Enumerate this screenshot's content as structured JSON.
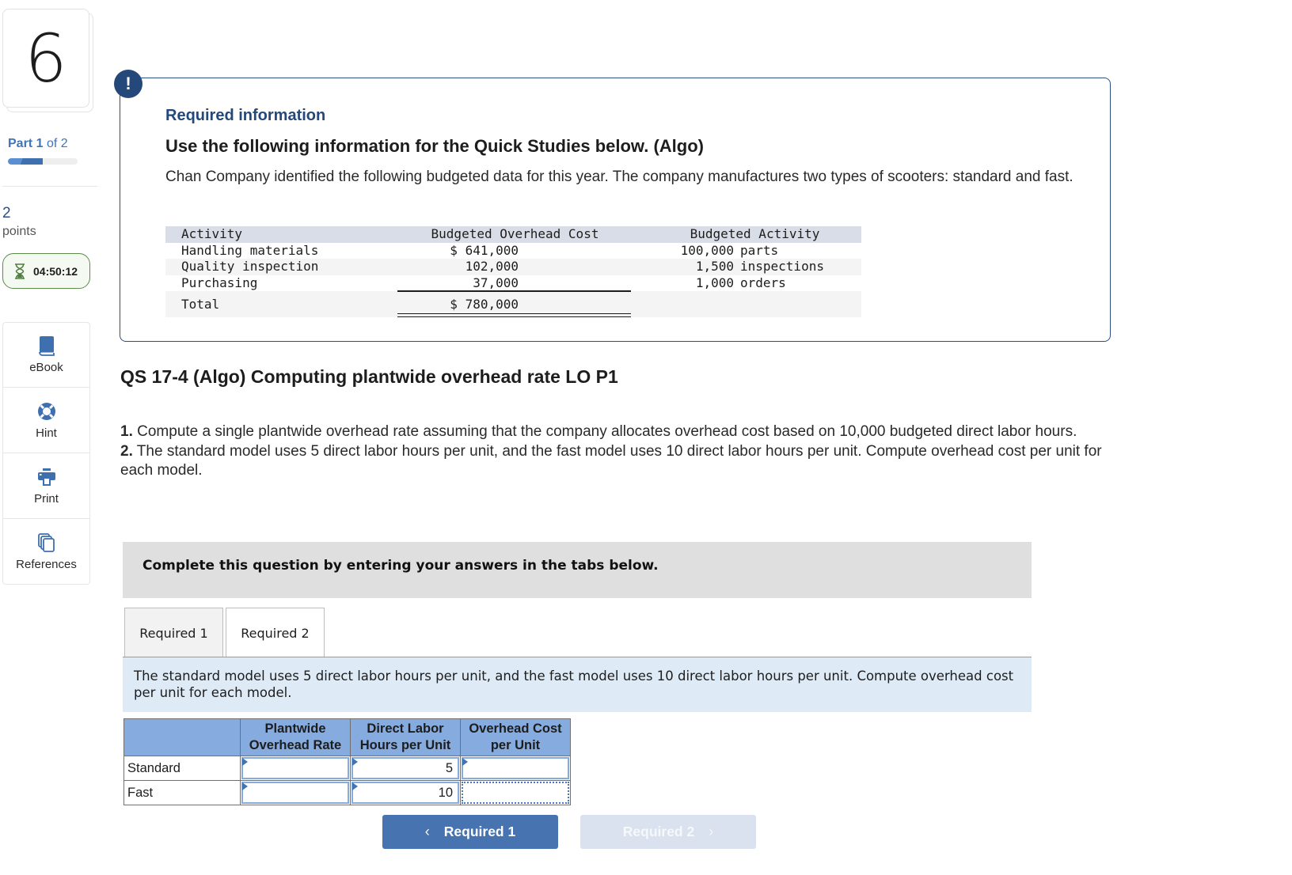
{
  "question": {
    "number": "6",
    "part_word": "Part",
    "part_current": "1",
    "part_of": "of 2",
    "part_progress_fraction": 0.5,
    "points_value": "2",
    "points_label": "points",
    "timer": "04:50:12"
  },
  "tools": [
    {
      "label": "eBook",
      "icon": "book-icon"
    },
    {
      "label": "Hint",
      "icon": "lifebuoy-icon"
    },
    {
      "label": "Print",
      "icon": "printer-icon"
    },
    {
      "label": "References",
      "icon": "copy-documents-icon"
    }
  ],
  "info": {
    "icon": "!",
    "heading": "Required information",
    "subheading": "Use the following information for the Quick Studies below. (Algo)",
    "intro": "Chan Company identified the following budgeted data for this year. The company manufactures two types of scooters: standard and fast.",
    "table": {
      "headers": [
        "Activity",
        "Budgeted Overhead Cost",
        "Budgeted Activity"
      ],
      "rows": [
        {
          "activity": "Handling materials",
          "cost": "$ 641,000",
          "qty": "100,000",
          "unit": "parts"
        },
        {
          "activity": "Quality inspection",
          "cost": "102,000",
          "qty": "1,500",
          "unit": "inspections"
        },
        {
          "activity": "Purchasing",
          "cost": "37,000",
          "qty": "1,000",
          "unit": "orders"
        }
      ],
      "total_label": "Total",
      "total_cost": "$ 780,000"
    }
  },
  "problem": {
    "title": "QS 17-4 (Algo) Computing plantwide overhead rate LO P1",
    "items": [
      {
        "num": "1.",
        "text": " Compute a single plantwide overhead rate assuming that the company allocates overhead cost based on 10,000 budgeted direct labor hours."
      },
      {
        "num": "2.",
        "text": " The standard model uses 5 direct labor hours per unit, and the fast model uses 10 direct labor hours per unit. Compute overhead cost per unit for each model."
      }
    ]
  },
  "answer_area": {
    "instruction": "Complete this question by entering your answers in the tabs below.",
    "tabs": [
      "Required 1",
      "Required 2"
    ],
    "active_tab": "Required 2",
    "description": "The standard model uses 5 direct labor hours per unit, and the fast model uses 10 direct labor hours per unit. Compute overhead cost per unit for each model.",
    "table": {
      "headers": [
        "",
        "Plantwide Overhead Rate",
        "Direct Labor Hours per Unit",
        "Overhead Cost per Unit"
      ],
      "rows": [
        {
          "label": "Standard",
          "rate": "",
          "hours": "5",
          "cost": ""
        },
        {
          "label": "Fast",
          "rate": "",
          "hours": "10",
          "cost": ""
        }
      ]
    },
    "prev_button": "Required 1",
    "next_button": "Required 2"
  }
}
